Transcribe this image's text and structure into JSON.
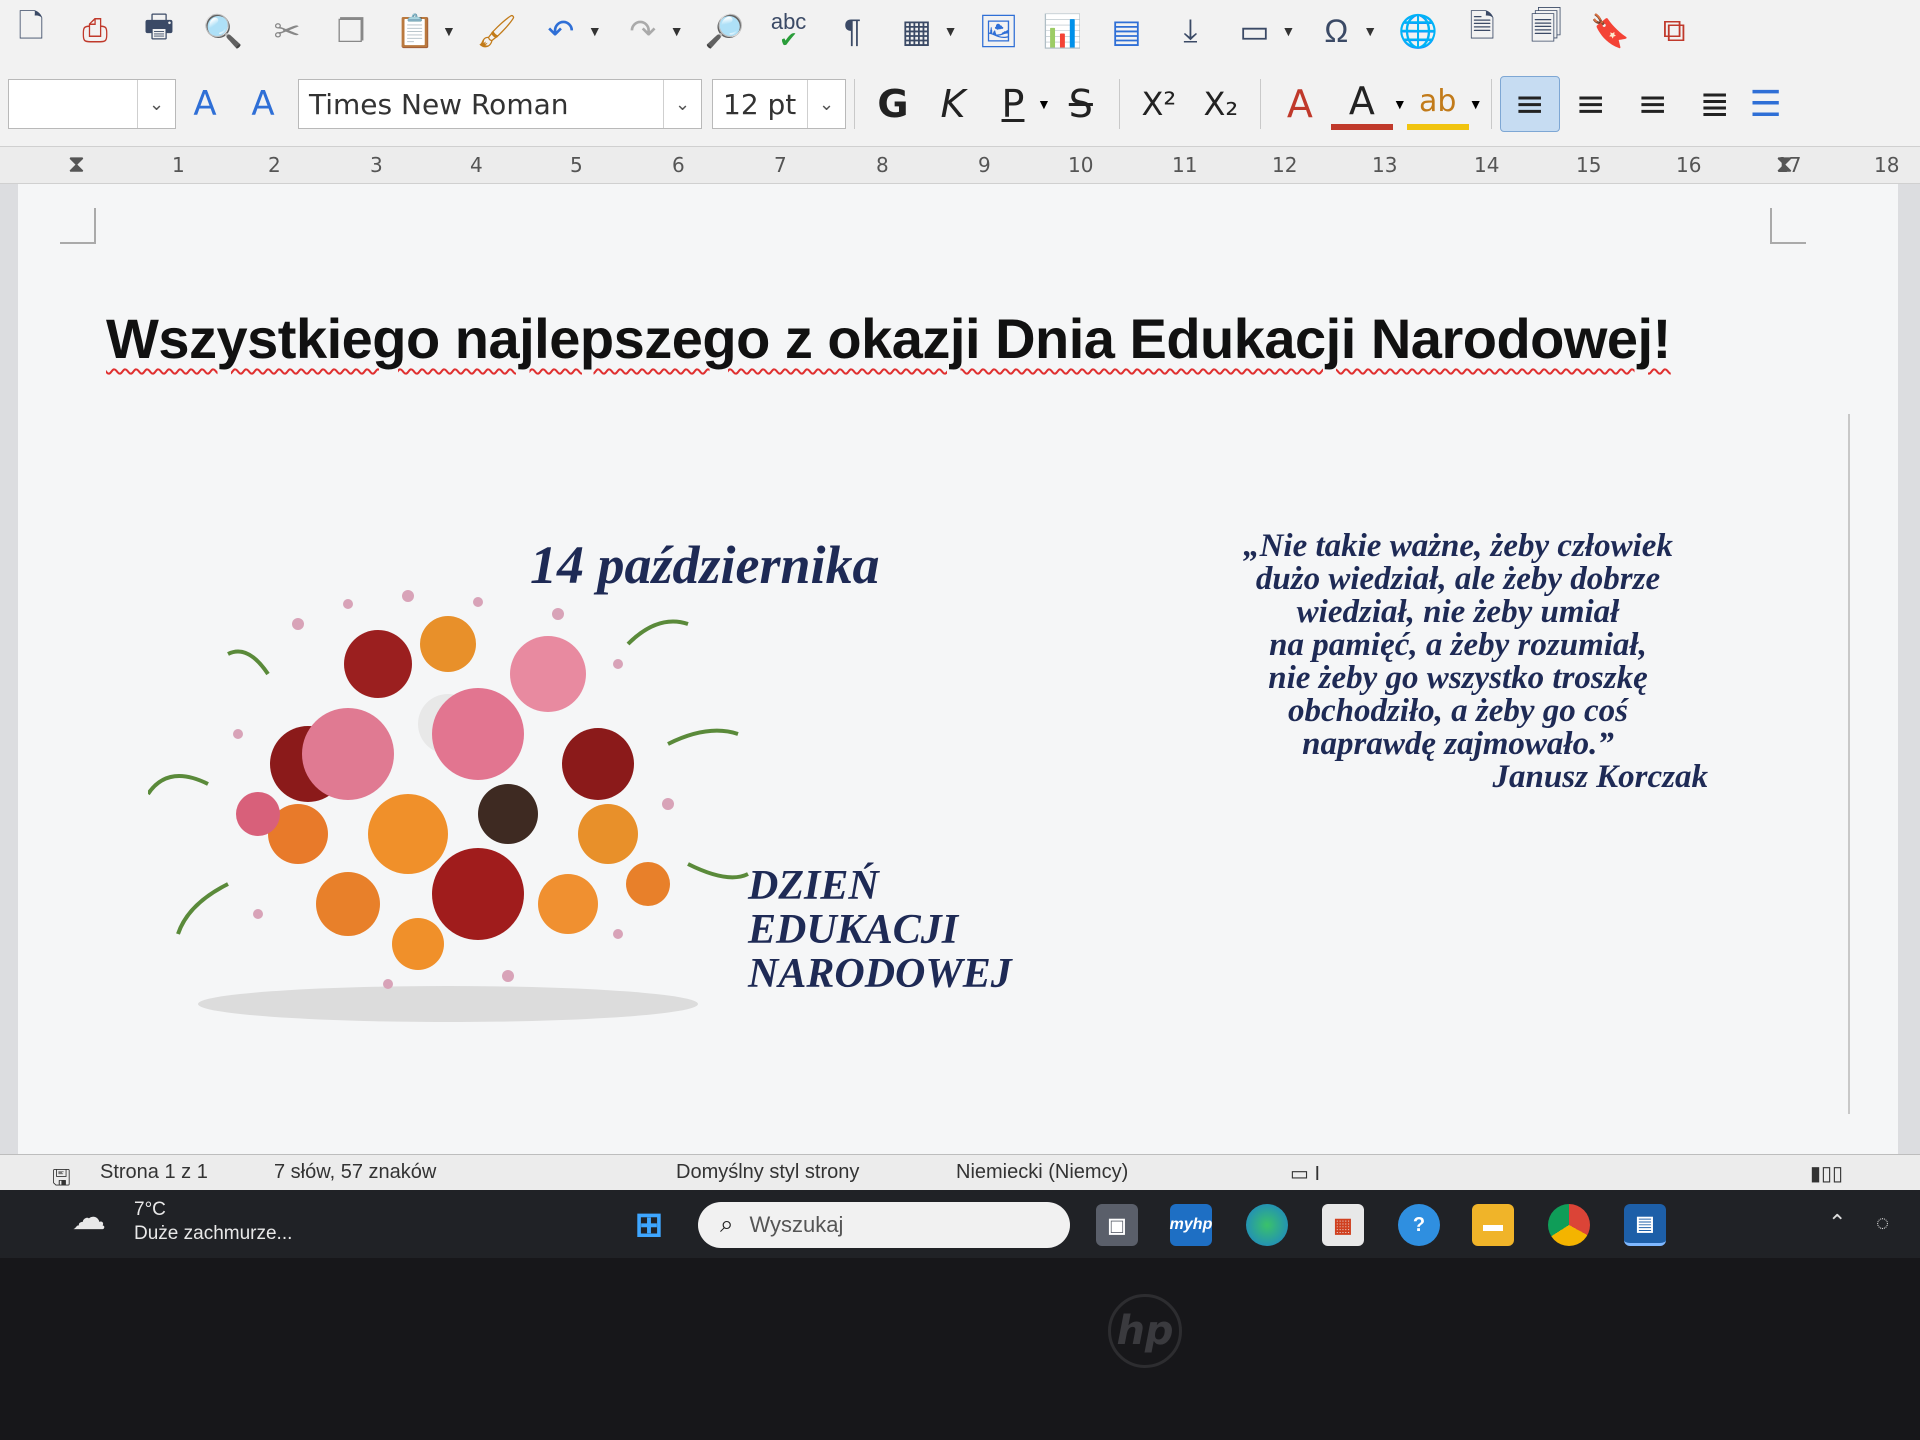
{
  "toolbar": {
    "style_name": "",
    "font_name": "Times New Roman",
    "font_size": "12 pt",
    "bold_label": "G",
    "italic_label": "K",
    "underline_label": "P",
    "strike_label": "S",
    "superscript_label": "X²",
    "subscript_label": "X₂",
    "font_color_label": "A",
    "spell_label": "abc"
  },
  "ruler": {
    "numbers": [
      "1",
      "2",
      "3",
      "4",
      "5",
      "6",
      "7",
      "8",
      "9",
      "10",
      "11",
      "12",
      "13",
      "14",
      "15",
      "16",
      "17",
      "18"
    ]
  },
  "document": {
    "heading": "Wszystkiego najlepszego z okazji Dnia Edukacji Narodowej!",
    "date": "14 października",
    "dzien_line1": "DZIEŃ",
    "dzien_line2": "EDUKACJI",
    "dzien_line3": "NARODOWEJ",
    "quote_lines": [
      "„Nie takie ważne, żeby człowiek",
      "dużo wiedział, ale żeby dobrze",
      "wiedział, nie żeby umiał",
      "na pamięć, a żeby rozumiał,",
      "nie  żeby go wszystko troszkę",
      "obchodziło, a żeby go coś",
      "naprawdę zajmowało.”"
    ],
    "quote_author": "Janusz Korczak"
  },
  "status_bar": {
    "page": "Strona 1 z 1",
    "words": "7 słów, 57 znaków",
    "page_style": "Domyślny styl strony",
    "language": "Niemiecki (Niemcy)"
  },
  "taskbar": {
    "temperature": "7°C",
    "weather": "Duże zachmurze...",
    "search_placeholder": "Wyszukaj",
    "myhp_label": "myhp"
  },
  "bezel": {
    "logo": "hp"
  },
  "colors": {
    "text_navy": "#1e2a55",
    "accent_blue": "#2f6fd6",
    "spell_error": "#e03030"
  }
}
